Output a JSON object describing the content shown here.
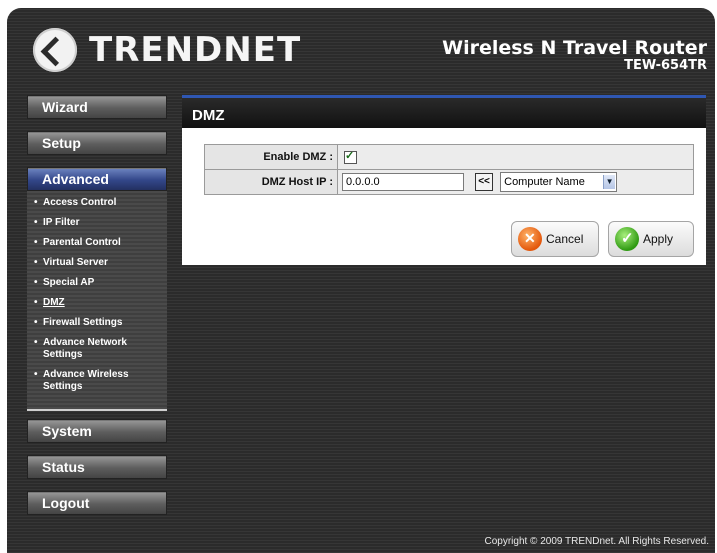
{
  "header": {
    "brand": "TRENDNET",
    "product_name": "Wireless N Travel Router",
    "model": "TEW-654TR"
  },
  "sidebar": {
    "wizard": "Wizard",
    "setup": "Setup",
    "advanced": "Advanced",
    "advanced_items": [
      "Access Control",
      "IP Filter",
      "Parental Control",
      "Virtual Server",
      "Special AP",
      "DMZ",
      "Firewall Settings",
      "Advance Network Settings",
      "Advance Wireless Settings"
    ],
    "system": "System",
    "status": "Status",
    "logout": "Logout"
  },
  "panel": {
    "title": "DMZ",
    "enable_label": "Enable DMZ :",
    "enable_checked": true,
    "host_label": "DMZ Host IP :",
    "host_value": "0.0.0.0",
    "copy_label": "<<",
    "computer_select": "Computer Name",
    "cancel": "Cancel",
    "apply": "Apply"
  },
  "footer": {
    "copyright": "Copyright © 2009 TRENDnet. All Rights Reserved."
  }
}
